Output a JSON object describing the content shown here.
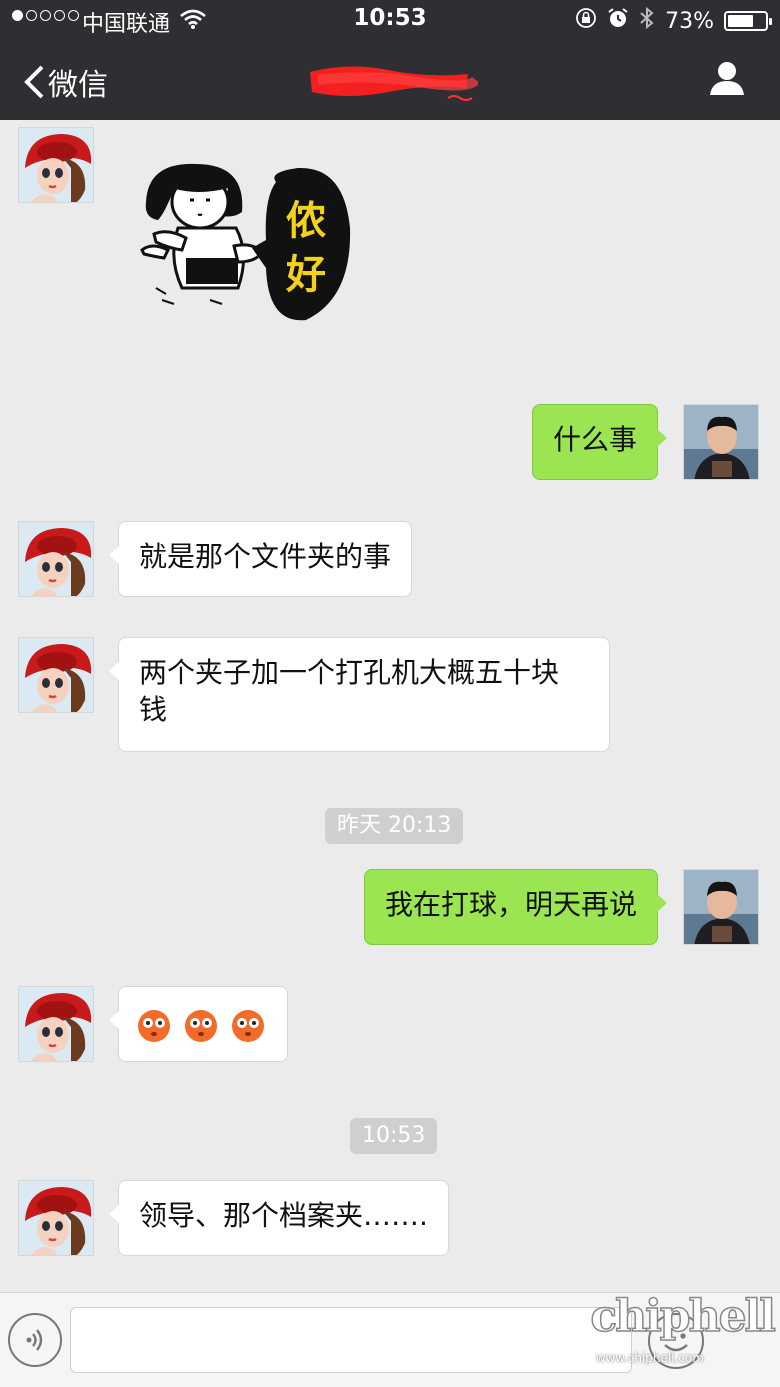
{
  "status_bar": {
    "carrier": "中国联通",
    "time": "10:53",
    "battery_text": "73%",
    "battery_level": 0.73
  },
  "nav": {
    "back_label": "微信",
    "title_redacted": true
  },
  "messages": [
    {
      "type": "sticker",
      "side": "left",
      "sticker_text": [
        "侬",
        "好"
      ]
    },
    {
      "type": "text",
      "side": "right",
      "text": "什么事"
    },
    {
      "type": "text",
      "side": "left",
      "text": "就是那个文件夹的事"
    },
    {
      "type": "text",
      "side": "left",
      "line1": "两个夹子加一个打孔机大概五十块",
      "line2": "钱"
    },
    {
      "type": "time",
      "text": "昨天 20:13"
    },
    {
      "type": "text",
      "side": "right",
      "text": "我在打球，明天再说"
    },
    {
      "type": "emoji",
      "side": "left",
      "emoji": [
        "flushed-face",
        "flushed-face",
        "flushed-face"
      ]
    },
    {
      "type": "time",
      "text": "10:53"
    },
    {
      "type": "text",
      "side": "left",
      "text": "领导、那个档案夹……."
    }
  ],
  "watermark": {
    "logo": "chiphell",
    "url": "www.chiphell.com"
  },
  "colors": {
    "header_bg": "#2e2e33",
    "chat_bg": "#ebebeb",
    "outgoing_bubble": "#9be553",
    "incoming_bubble": "#ffffff",
    "redaction": "#ff2020"
  }
}
